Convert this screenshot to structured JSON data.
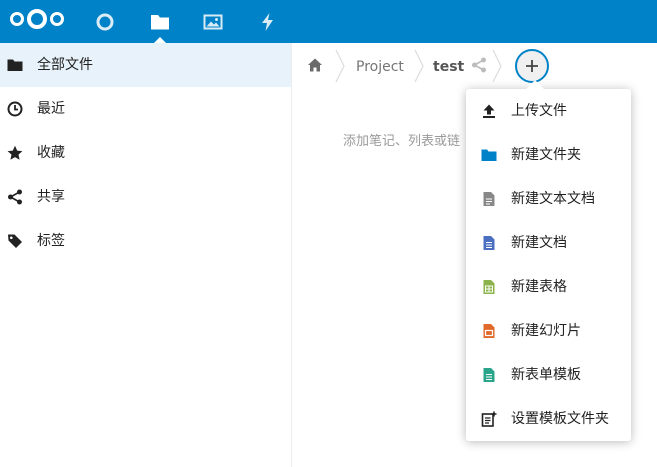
{
  "header": {
    "apps": [
      {
        "name": "dashboard-icon"
      },
      {
        "name": "files-icon",
        "active": true
      },
      {
        "name": "photos-icon"
      },
      {
        "name": "activity-icon"
      }
    ],
    "brand_color": "#0082c9"
  },
  "sidebar": {
    "items": [
      {
        "label": "全部文件",
        "icon": "folder-icon",
        "active": true
      },
      {
        "label": "最近",
        "icon": "clock-icon"
      },
      {
        "label": "收藏",
        "icon": "star-icon"
      },
      {
        "label": "共享",
        "icon": "share-icon"
      },
      {
        "label": "标签",
        "icon": "tag-icon"
      }
    ]
  },
  "breadcrumb": {
    "items": [
      "Project",
      "test"
    ]
  },
  "empty_hint": "添加笔记、列表或链",
  "new_menu": {
    "items": [
      {
        "label": "上传文件",
        "icon": "upload-icon"
      },
      {
        "label": "新建文件夹",
        "icon": "folder-icon"
      },
      {
        "label": "新建文本文档",
        "icon": "text-file-icon"
      },
      {
        "label": "新建文档",
        "icon": "document-icon"
      },
      {
        "label": "新建表格",
        "icon": "spreadsheet-icon"
      },
      {
        "label": "新建幻灯片",
        "icon": "presentation-icon"
      },
      {
        "label": "新表单模板",
        "icon": "form-template-icon"
      },
      {
        "label": "设置模板文件夹",
        "icon": "template-folder-icon"
      }
    ]
  },
  "colors": {
    "text_file": "#888888",
    "document": "#4a6fc0",
    "spreadsheet": "#8ab34a",
    "presentation": "#e06a2a",
    "form": "#2aa48a",
    "folder": "#0082c9"
  }
}
